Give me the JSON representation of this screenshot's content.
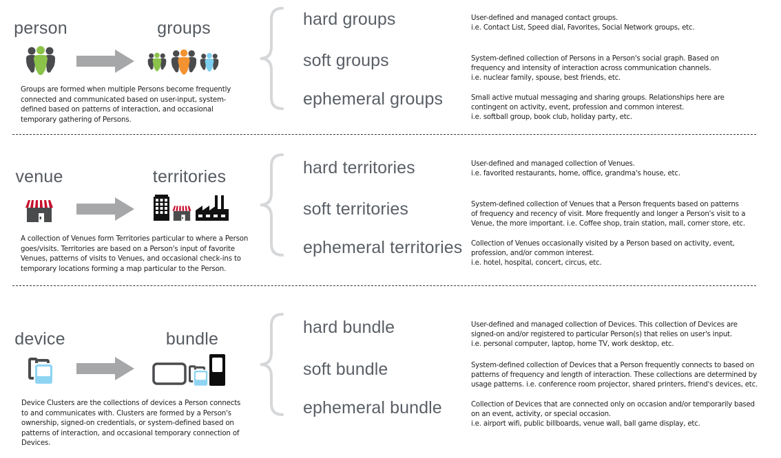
{
  "colors": {
    "icon_dark": "#4a4b4d",
    "green": "#8bc34a",
    "orange": "#f39230",
    "blue": "#7ccff0",
    "awning_red": "#c8102e",
    "arrow_gray": "#a6a7a9",
    "brace_gray": "#d6d7d9"
  },
  "sections": [
    {
      "id": "groups",
      "source_label": "person",
      "target_label": "groups",
      "source_icon": "person-icon",
      "target_icons": [
        "group-green-icon",
        "group-orange-icon",
        "group-blue-icon"
      ],
      "description_lines": [
        "Groups are formed when multiple Persons become frequently",
        "connected and communicated based on user-input, system-",
        "defined based on patterns of interaction, and occasional",
        "temporary gathering of Persons."
      ],
      "types": [
        {
          "label": "hard groups",
          "lines": [
            "User-defined and managed contact groups.",
            "i.e. Contact List, Speed dial, Favorites, Social Network groups, etc."
          ]
        },
        {
          "label": "soft groups",
          "lines": [
            "System-defined collection of Persons in a Person's social graph. Based on",
            "frequency and intensity of interaction across communication channels.",
            "i.e. nuclear family, spouse, best friends, etc."
          ]
        },
        {
          "label": "ephemeral groups",
          "lines": [
            "Small active mutual messaging and sharing groups. Relationships here are",
            "contingent on activity, event, profession and common interest.",
            "i.e. softball group, book club, holiday party, etc."
          ]
        }
      ]
    },
    {
      "id": "territories",
      "source_label": "venue",
      "target_label": "territories",
      "source_icon": "store-icon",
      "target_icons": [
        "office-building-icon",
        "store-icon",
        "factory-icon"
      ],
      "description_lines": [
        "A collection of Venues form Territories particular to where a Person",
        "goes/visits. Territories are based on a Person's input of favorite",
        "Venues, patterns of visits to Venues, and occasional check-ins to",
        "temporary locations forming a map particular to the Person."
      ],
      "types": [
        {
          "label": "hard territories",
          "lines": [
            "User-defined and managed collection of Venues.",
            "i.e. favorited restaurants, home, office, grandma's house, etc."
          ]
        },
        {
          "label": "soft territories",
          "lines": [
            "System-defined collection of Venues that a Person frequents based on patterns",
            "of frequency and recency of visit. More frequently and longer a Person's visit to a",
            "Venue, the more important. i.e. Coffee shop, train station, mall, corner store, etc."
          ]
        },
        {
          "label": "ephemeral territories",
          "lines": [
            "Collection of Venues occasionally visited by a Person based on activity, event,",
            "profession, and/or common interest.",
            "i.e. hotel, hospital, concert, circus, etc."
          ]
        }
      ]
    },
    {
      "id": "bundle",
      "source_label": "device",
      "target_label": "bundle",
      "source_icon": "device-icon",
      "target_icons": [
        "tv-screen-icon",
        "device-icon",
        "phone-icon"
      ],
      "description_lines": [
        "Device Clusters are the collections of devices a Person connects",
        "to and communicates with. Clusters are formed by a Person's",
        "ownership, signed-on credentials, or system-defined based on",
        "patterns of interaction, and occasional temporary connection of",
        "Devices."
      ],
      "types": [
        {
          "label": "hard bundle",
          "lines": [
            "User-defined and managed collection of Devices. This collection of Devices are",
            "signed-on and/or registered to particular Person(s) that relies on user's input.",
            "i.e. personal computer, laptop, home TV, work desktop, etc."
          ]
        },
        {
          "label": "soft bundle",
          "lines": [
            "System-defined collection of Devices that a Person frequently connects to based on",
            "patterns of frequency and length of interaction. These collections are determined by",
            "usage patterns. i.e. conference room projector, shared printers, friend's devices, etc."
          ]
        },
        {
          "label": "ephemeral bundle",
          "lines": [
            "Collection of Devices that are connected only on occasion and/or temporarily based",
            "on an event, activity, or special occasion.",
            "i.e. airport wifi, public billboards, venue wall, ball game display, etc."
          ]
        }
      ]
    }
  ]
}
